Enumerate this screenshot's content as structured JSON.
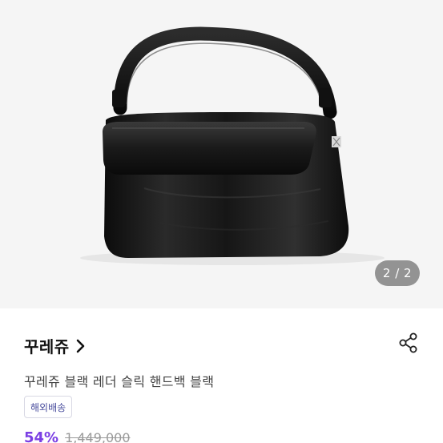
{
  "gallery": {
    "counter": "2 / 2",
    "image_subject": "black-leather-handbag"
  },
  "product": {
    "brand": "꾸레쥬",
    "title": "꾸레쥬 블랙 레더 슬릭 핸드백 블랙",
    "shipping_badge": "해외배송",
    "discount_rate": "54%",
    "original_price": "1,449,000"
  },
  "colors": {
    "accent": "#7b3fe4",
    "badge_text": "#4a4e9e",
    "hero_background": "#f5f5f5"
  }
}
